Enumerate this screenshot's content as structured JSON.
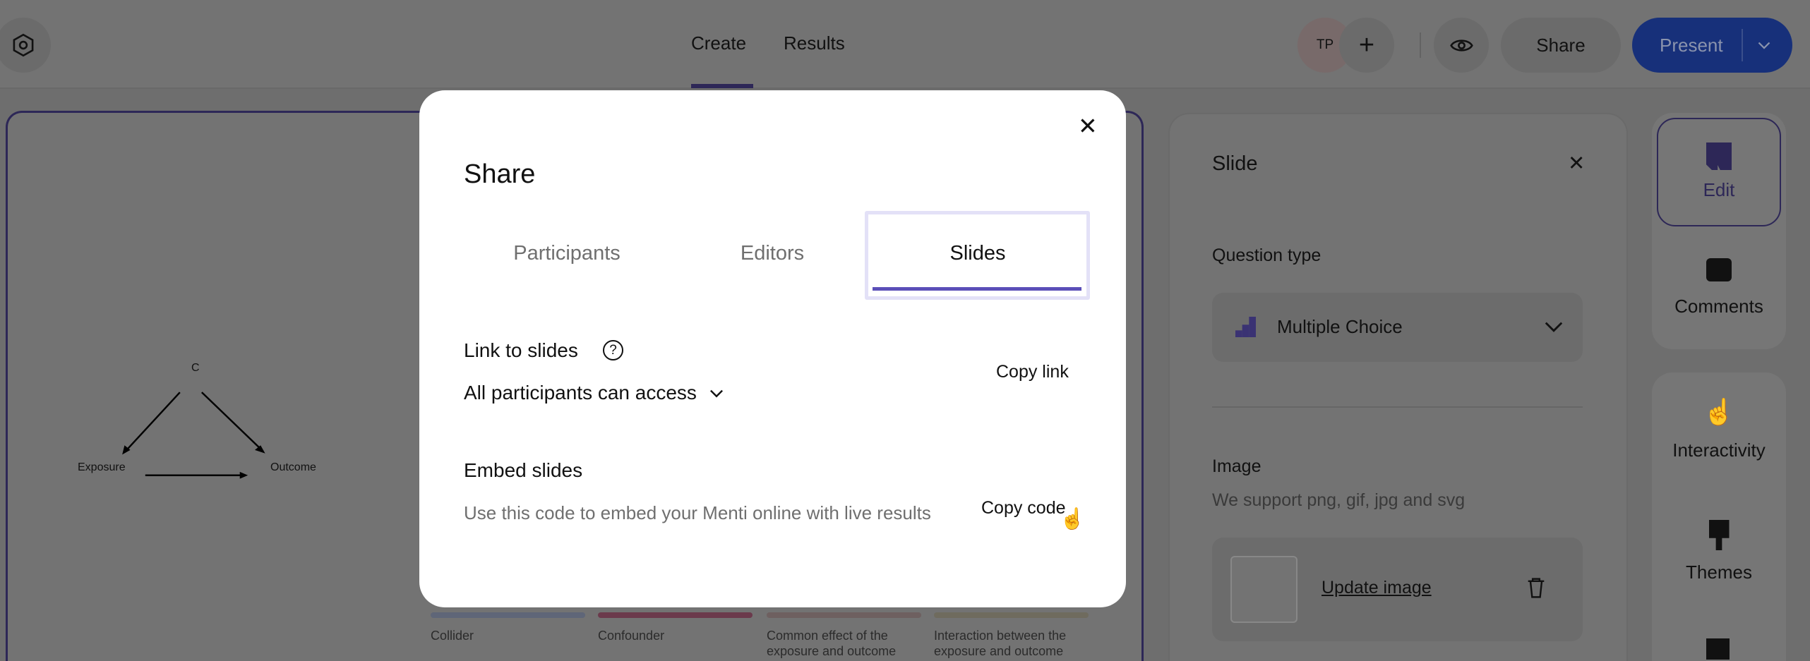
{
  "topbar": {
    "tabs": [
      {
        "label": "Create",
        "active": true
      },
      {
        "label": "Results"
      }
    ],
    "avatar_initials": "TP",
    "share_label": "Share",
    "present_label": "Present",
    "accent": "#17307a"
  },
  "slide": {
    "diagram": {
      "top": "C",
      "left": "Exposure",
      "right": "Outcome"
    },
    "options": [
      {
        "label": "Collider",
        "color": "#5f6678"
      },
      {
        "label": "Confounder",
        "color": "#6b3a4c"
      },
      {
        "label": "Common effect of the exposure and outcome",
        "color": "#6e6060"
      },
      {
        "label": "Interaction between the exposure and outcome",
        "color": "#6f6b5e"
      }
    ]
  },
  "panel": {
    "title": "Slide",
    "question_type_label": "Question type",
    "question_type_value": "Multiple Choice",
    "image_label": "Image",
    "image_hint": "We support png, gif, jpg and svg",
    "update_image": "Update image"
  },
  "sidebar": {
    "items": [
      {
        "label": "Edit",
        "icon": "edit-icon"
      },
      {
        "label": "Comments",
        "icon": "comment-icon"
      },
      {
        "label": "Interactivity",
        "icon": "tap-icon"
      },
      {
        "label": "Themes",
        "icon": "brush-icon"
      }
    ]
  },
  "modal": {
    "title": "Share",
    "tabs": [
      {
        "label": "Participants"
      },
      {
        "label": "Editors"
      },
      {
        "label": "Slides",
        "active": true
      }
    ],
    "link_title": "Link to slides",
    "access": "All participants can access",
    "copy_link": "Copy link",
    "embed_title": "Embed slides",
    "embed_desc": "Use this code to embed your Menti online with live results",
    "copy_code": "Copy code",
    "accent": "#5b4fb8"
  }
}
